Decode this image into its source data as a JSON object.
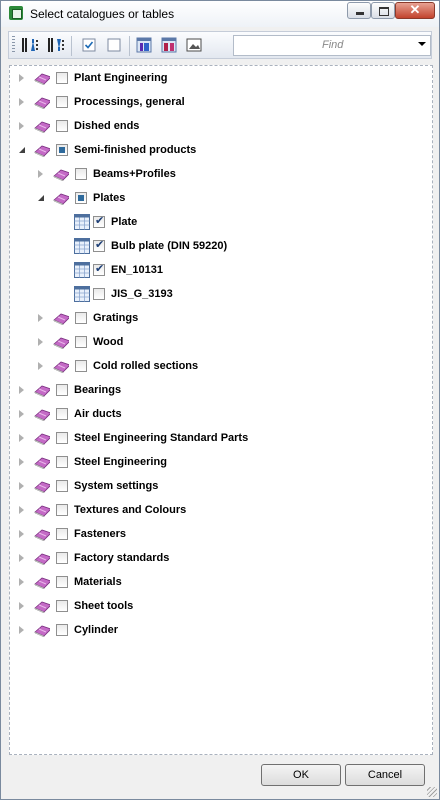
{
  "window": {
    "title": "Select catalogues or tables",
    "close_glyph": "✕"
  },
  "toolbar": {
    "icons": [
      "sort-ascending-icon",
      "sort-descending-icon",
      "check-all-icon",
      "uncheck-all-icon",
      "table-id-icon",
      "table-ab-icon",
      "image-icon"
    ]
  },
  "find": {
    "placeholder": "Find"
  },
  "tree": [
    {
      "label": "Plant Engineering",
      "level": 0,
      "kind": "catalogue",
      "expander": "collapsed",
      "check": "unchecked"
    },
    {
      "label": "Processings, general",
      "level": 0,
      "kind": "catalogue",
      "expander": "collapsed",
      "check": "unchecked"
    },
    {
      "label": "Dished ends",
      "level": 0,
      "kind": "catalogue",
      "expander": "collapsed",
      "check": "unchecked"
    },
    {
      "label": "Semi-finished products",
      "level": 0,
      "kind": "catalogue",
      "expander": "expanded",
      "check": "partial"
    },
    {
      "label": "Beams+Profiles",
      "level": 1,
      "kind": "catalogue",
      "expander": "collapsed",
      "check": "unchecked"
    },
    {
      "label": "Plates",
      "level": 1,
      "kind": "catalogue",
      "expander": "expanded",
      "check": "partial"
    },
    {
      "label": "Plate",
      "level": 2,
      "kind": "table",
      "expander": "none",
      "check": "checked"
    },
    {
      "label": "Bulb plate (DIN 59220)",
      "level": 2,
      "kind": "table",
      "expander": "none",
      "check": "checked"
    },
    {
      "label": "EN_10131",
      "level": 2,
      "kind": "table",
      "expander": "none",
      "check": "checked"
    },
    {
      "label": "JIS_G_3193",
      "level": 2,
      "kind": "table",
      "expander": "none",
      "check": "unchecked"
    },
    {
      "label": "Gratings",
      "level": 1,
      "kind": "catalogue",
      "expander": "collapsed",
      "check": "unchecked"
    },
    {
      "label": "Wood",
      "level": 1,
      "kind": "catalogue",
      "expander": "collapsed",
      "check": "unchecked"
    },
    {
      "label": "Cold rolled sections",
      "level": 1,
      "kind": "catalogue",
      "expander": "collapsed",
      "check": "unchecked"
    },
    {
      "label": "Bearings",
      "level": 0,
      "kind": "catalogue",
      "expander": "collapsed",
      "check": "unchecked"
    },
    {
      "label": "Air ducts",
      "level": 0,
      "kind": "catalogue",
      "expander": "collapsed",
      "check": "unchecked"
    },
    {
      "label": "Steel Engineering Standard Parts",
      "level": 0,
      "kind": "catalogue",
      "expander": "collapsed",
      "check": "unchecked"
    },
    {
      "label": "Steel Engineering",
      "level": 0,
      "kind": "catalogue",
      "expander": "collapsed",
      "check": "unchecked"
    },
    {
      "label": "System settings",
      "level": 0,
      "kind": "catalogue",
      "expander": "collapsed",
      "check": "unchecked"
    },
    {
      "label": "Textures and Colours",
      "level": 0,
      "kind": "catalogue",
      "expander": "collapsed",
      "check": "unchecked"
    },
    {
      "label": "Fasteners",
      "level": 0,
      "kind": "catalogue",
      "expander": "collapsed",
      "check": "unchecked"
    },
    {
      "label": "Factory standards",
      "level": 0,
      "kind": "catalogue",
      "expander": "collapsed",
      "check": "unchecked"
    },
    {
      "label": "Materials",
      "level": 0,
      "kind": "catalogue",
      "expander": "collapsed",
      "check": "unchecked"
    },
    {
      "label": "Sheet tools",
      "level": 0,
      "kind": "catalogue",
      "expander": "collapsed",
      "check": "unchecked"
    },
    {
      "label": "Cylinder",
      "level": 0,
      "kind": "catalogue",
      "expander": "collapsed",
      "check": "unchecked"
    }
  ],
  "buttons": {
    "ok": "OK",
    "cancel": "Cancel"
  }
}
